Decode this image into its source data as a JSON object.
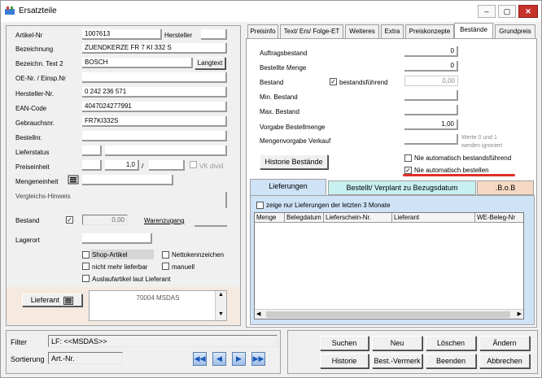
{
  "window": {
    "title": "Ersatzteile",
    "min": "–",
    "max": "▢",
    "close": "✕"
  },
  "left": {
    "artikel_nr": {
      "label": "Artikel-Nr",
      "value": "1007613"
    },
    "hersteller": {
      "label": "Hersteller"
    },
    "bezeichnung": {
      "label": "Bezeichnung",
      "value": "ZUENDKERZE FR 7 KI 332 S"
    },
    "bezeichn2": {
      "label": "Bezeichn. Text 2",
      "value": "BOSCH"
    },
    "langtext": {
      "label": "Langtext"
    },
    "oe_nr": {
      "label": "OE-Nr. / Einsp.Nr",
      "value": ""
    },
    "hersteller_nr": {
      "label": "Hersteller-Nr.",
      "value": "0 242 236 571"
    },
    "ean": {
      "label": "EAN-Code",
      "value": "4047024277991"
    },
    "gebrauchsnr": {
      "label": "Gebrauchsnr.",
      "value": "FR7KI332S"
    },
    "bestellnr": {
      "label": "Bestellnr.",
      "value": ""
    },
    "lieferstatus": {
      "label": "Lieferstatus"
    },
    "preiseinheit": {
      "label": "Preiseinheit",
      "value": "1,0",
      "sep": "/"
    },
    "vk_divid": {
      "label": "VK divid."
    },
    "mengeneinheit": {
      "label": "Mengeneinheit"
    },
    "vergleichs": {
      "label": "Vergleichs-Hinweis"
    },
    "bestand": {
      "label": "Bestand",
      "value": "0,00",
      "checked": "✓"
    },
    "warenzugang": {
      "label": "Warenzugang"
    },
    "lagerort": {
      "label": "Lagerort"
    },
    "shop_artikel": {
      "label": "Shop-Artikel"
    },
    "nettokennzeichen": {
      "label": "Nettokennzeichen"
    },
    "nicht_lieferbar": {
      "label": "nicht mehr lieferbar"
    },
    "manuell": {
      "label": "manuell"
    },
    "auslauf": {
      "label": "Auslaufartikel laut Lieferant"
    },
    "lieferant": {
      "label": "Lieferant",
      "value": "70004 MSDAS"
    }
  },
  "tabs": [
    "Preisinfo",
    "Text/ Ers/ Folge-ET",
    "Weiteres",
    "Extra",
    "Preiskonzepte",
    "Bestände",
    "Grundpreis"
  ],
  "bestaende": {
    "auftragsbestand": {
      "label": "Auftragsbestand",
      "value": "0"
    },
    "bestellte_menge": {
      "label": "Bestellte Menge",
      "value": "0"
    },
    "bestand": {
      "label": "Bestand",
      "value": "0,00"
    },
    "bestandsfuehrend": {
      "label": "bestandsführend",
      "checked": "✓"
    },
    "min_bestand": {
      "label": "Min. Bestand",
      "value": ""
    },
    "max_bestand": {
      "label": "Max. Bestand",
      "value": ""
    },
    "vorgabe": {
      "label": "Vorgabe Bestellmenge",
      "value": "1,00"
    },
    "mengenvorgabe": {
      "label": "Mengenvorgabe Verkauf",
      "value": ""
    },
    "hint": {
      "line1": "Werte 0 und 1",
      "line2": "werden ignoriert"
    },
    "historie_button": "Historie Bestände",
    "nie_bestandsfuehrend": {
      "label": "Nie automatisch bestandsführend",
      "checked": ""
    },
    "nie_bestellen": {
      "label": "Nie automatisch bestellen",
      "checked": "✓"
    }
  },
  "subtabs": [
    "Lieferungen",
    "Bestellt/ Verplant zu Bezugsdatum",
    ".B.o.B"
  ],
  "lieferungen": {
    "filter_label": "zeige nur Lieferungen der letzten 3 Monate",
    "columns": [
      "Menge",
      "Belegdatum",
      "Lieferschein-Nr.",
      "Lieferant",
      "WE-Beleg-Nr"
    ]
  },
  "bottom": {
    "filter": {
      "label": "Filter",
      "value": "LF: <<MSDAS>>"
    },
    "sortierung": {
      "label": "Sortierung",
      "value": "Art.-Nr."
    },
    "buttons": {
      "suchen": "Suchen",
      "neu": "Neu",
      "loeschen": "Löschen",
      "aendern": "Ändern",
      "historie": "Historie",
      "best_vermerk": "Best.-Vermerk",
      "beenden": "Beenden",
      "abbrechen": "Abbrechen"
    }
  },
  "colors": {
    "tab_blue": "#cfe3f7",
    "tab_cyan": "#c8f0f0",
    "tab_peach": "#f5d9c4",
    "highlight": "#e0302a",
    "nav_blue": "#1a56b8"
  }
}
